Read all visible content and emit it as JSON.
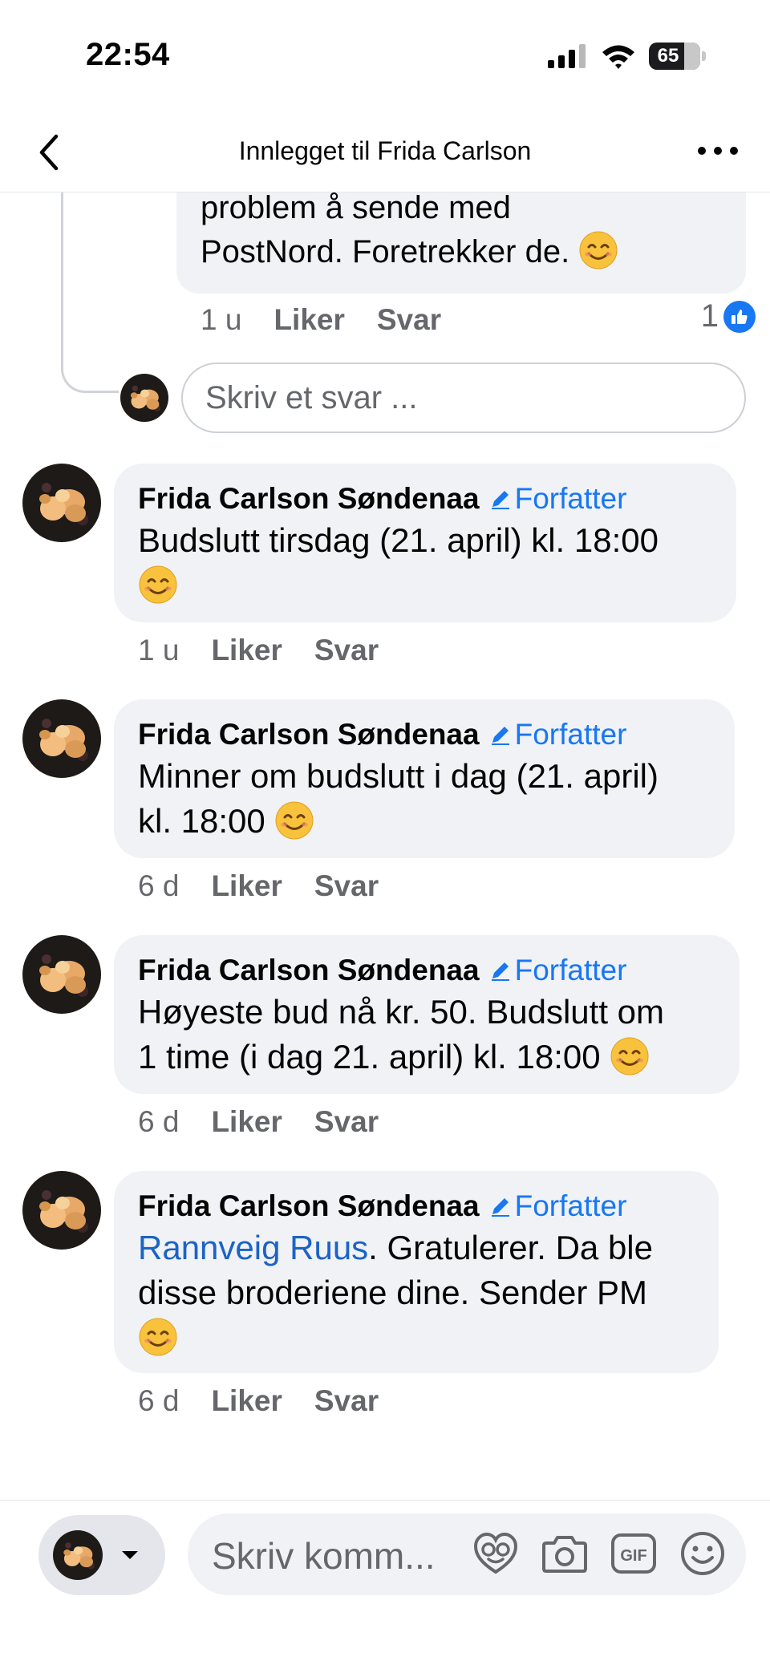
{
  "status": {
    "time": "22:54",
    "battery": "65"
  },
  "nav": {
    "title": "Innlegget til Frida Carlson"
  },
  "reply": {
    "text_line1": "problem å sende med",
    "text_line2": "PostNord. Foretrekker de.",
    "time": "1 u",
    "like_label": "Liker",
    "reply_label": "Svar",
    "like_count": "1",
    "input_placeholder": "Skriv et svar ..."
  },
  "comments": [
    {
      "author": "Frida Carlson Søndenaa",
      "badge": "Forfatter",
      "line1": "Budslutt tirsdag (21. april) kl. 18:00",
      "line2": "",
      "time": "1 u",
      "like_label": "Liker",
      "reply_label": "Svar"
    },
    {
      "author": "Frida Carlson Søndenaa",
      "badge": "Forfatter",
      "line1": "Minner om budslutt i dag (21. april)",
      "line2": "kl. 18:00",
      "time": "6 d",
      "like_label": "Liker",
      "reply_label": "Svar"
    },
    {
      "author": "Frida Carlson Søndenaa",
      "badge": "Forfatter",
      "line1": "Høyeste bud nå kr. 50. Budslutt om",
      "line2": "1 time (i dag 21. april) kl. 18:00",
      "time": "6 d",
      "like_label": "Liker",
      "reply_label": "Svar"
    },
    {
      "author": "Frida Carlson Søndenaa",
      "badge": "Forfatter",
      "mention": "Rannveig Ruus",
      "line1": ". Gratulerer. Da ble",
      "line2": "disse broderiene dine. Sender PM",
      "time": "6 d",
      "like_label": "Liker",
      "reply_label": "Svar"
    }
  ],
  "composer": {
    "placeholder": "Skriv komm..."
  },
  "icons": {
    "back": "chevron-left-icon",
    "more": "more-dots-icon",
    "like_badge": "thumbs-up-icon",
    "author_badge": "pencil-icon",
    "emoji": "smiling-face-icon",
    "avatar_dropdown": "caret-down-icon",
    "avatar_sticker": "avatar-sticker-icon",
    "camera": "camera-icon",
    "gif": "gif-icon",
    "emoji_picker": "emoji-icon"
  },
  "colors": {
    "accent": "#1877f2",
    "bubble": "#f0f2f5",
    "secondary_text": "#65676b",
    "mention": "#1b63c6"
  }
}
